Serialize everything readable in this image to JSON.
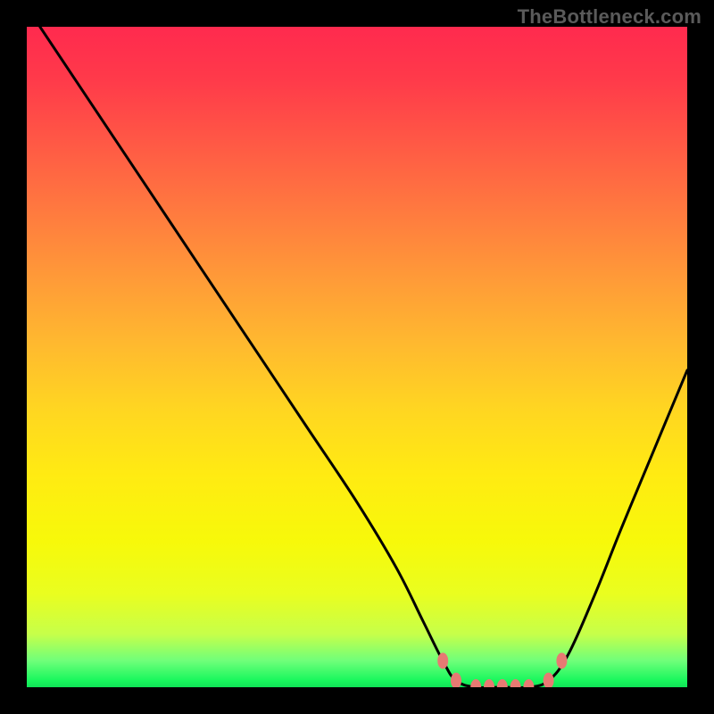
{
  "watermark": "TheBottleneck.com",
  "chart_data": {
    "type": "line",
    "title": "",
    "xlabel": "",
    "ylabel": "",
    "xlim": [
      0,
      100
    ],
    "ylim": [
      0,
      100
    ],
    "gradient_background": {
      "direction": "vertical",
      "stops": [
        {
          "pos": 0,
          "color": "#ff2a4e",
          "meaning": "high-bottleneck"
        },
        {
          "pos": 50,
          "color": "#ffb92f",
          "meaning": "mid"
        },
        {
          "pos": 80,
          "color": "#f7f90a",
          "meaning": "low"
        },
        {
          "pos": 100,
          "color": "#18f75d",
          "meaning": "no-bottleneck"
        }
      ]
    },
    "series": [
      {
        "name": "bottleneck-curve",
        "color": "#000000",
        "points": [
          {
            "x": 2,
            "y": 100
          },
          {
            "x": 10,
            "y": 88
          },
          {
            "x": 18,
            "y": 76
          },
          {
            "x": 26,
            "y": 64
          },
          {
            "x": 34,
            "y": 52
          },
          {
            "x": 42,
            "y": 40
          },
          {
            "x": 50,
            "y": 28
          },
          {
            "x": 56,
            "y": 18
          },
          {
            "x": 60,
            "y": 10
          },
          {
            "x": 63,
            "y": 4
          },
          {
            "x": 65,
            "y": 1
          },
          {
            "x": 68,
            "y": 0
          },
          {
            "x": 72,
            "y": 0
          },
          {
            "x": 76,
            "y": 0
          },
          {
            "x": 79,
            "y": 1
          },
          {
            "x": 82,
            "y": 5
          },
          {
            "x": 86,
            "y": 14
          },
          {
            "x": 90,
            "y": 24
          },
          {
            "x": 95,
            "y": 36
          },
          {
            "x": 100,
            "y": 48
          }
        ]
      }
    ],
    "markers": [
      {
        "x": 63,
        "y": 4,
        "color": "#e77a73"
      },
      {
        "x": 65,
        "y": 1,
        "color": "#e77a73"
      },
      {
        "x": 68,
        "y": 0,
        "color": "#e77a73"
      },
      {
        "x": 70,
        "y": 0,
        "color": "#e77a73"
      },
      {
        "x": 72,
        "y": 0,
        "color": "#e77a73"
      },
      {
        "x": 74,
        "y": 0,
        "color": "#e77a73"
      },
      {
        "x": 76,
        "y": 0,
        "color": "#e77a73"
      },
      {
        "x": 79,
        "y": 1,
        "color": "#e77a73"
      },
      {
        "x": 81,
        "y": 4,
        "color": "#e77a73"
      }
    ]
  }
}
